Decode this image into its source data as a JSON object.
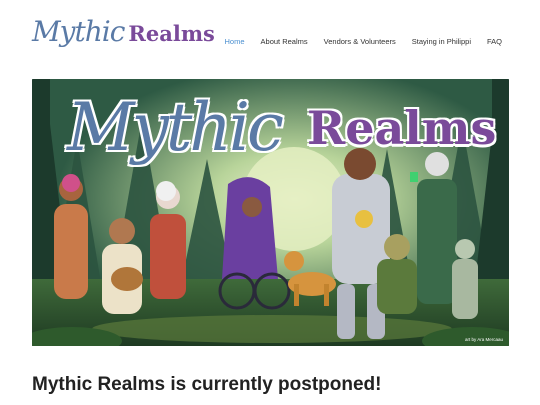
{
  "site": {
    "logo_script": "Mythic",
    "logo_bold": "Realms"
  },
  "nav": {
    "items": [
      {
        "label": "Home",
        "active": true
      },
      {
        "label": "About Realms",
        "active": false
      },
      {
        "label": "Vendors & Volunteers",
        "active": false
      },
      {
        "label": "Staying in Philippi",
        "active": false
      },
      {
        "label": "FAQ",
        "active": false
      }
    ]
  },
  "hero": {
    "title_script": "Mythic",
    "title_bold": "Realms",
    "credit": "art by Ara Mercaau"
  },
  "headline": "Mythic Realms is currently postponed!",
  "colors": {
    "nav_active": "#4a8fd0",
    "logo_blue": "#5a7aa6",
    "logo_purple": "#7a4a9a",
    "forest_dark": "#1f3d2e",
    "moon": "#e8f0c8"
  }
}
